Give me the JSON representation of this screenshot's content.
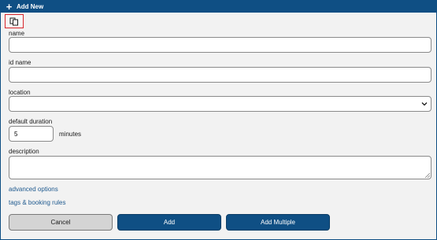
{
  "dialog": {
    "title": "Add New",
    "title_icon": "plus-icon",
    "copy_icon": "copy-icon"
  },
  "form": {
    "name": {
      "label": "name",
      "value": ""
    },
    "id_name": {
      "label": "id name",
      "value": ""
    },
    "location": {
      "label": "location",
      "value": ""
    },
    "default_duration": {
      "label": "default duration",
      "value": "5",
      "unit": "minutes"
    },
    "description": {
      "label": "description",
      "value": ""
    }
  },
  "links": {
    "advanced_options": "advanced options",
    "tags_booking_rules": "tags & booking rules"
  },
  "buttons": {
    "cancel": "Cancel",
    "add": "Add",
    "add_multiple": "Add Multiple"
  },
  "colors": {
    "primary": "#0f4f84",
    "highlight_border": "#d8262b",
    "link": "#1f5a8f",
    "background": "#f2f2f2"
  }
}
